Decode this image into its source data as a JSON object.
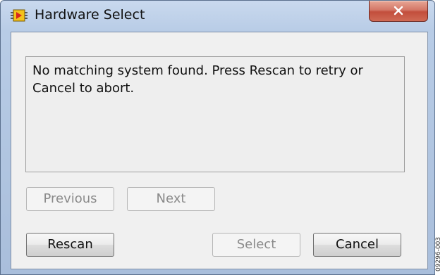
{
  "window": {
    "title": "Hardware Select",
    "close_glyph": "x",
    "icon": "labview-app-icon"
  },
  "message": {
    "text": "No matching system found. Press Rescan to retry or Cancel to abort."
  },
  "buttons": {
    "previous": "Previous",
    "next": "Next",
    "rescan": "Rescan",
    "select": "Select",
    "cancel": "Cancel"
  },
  "figure_code": "09296-003",
  "colors": {
    "close_button": "#c24e3c",
    "title_bar": "#b8cce6",
    "client_background": "#f0f0f0"
  }
}
